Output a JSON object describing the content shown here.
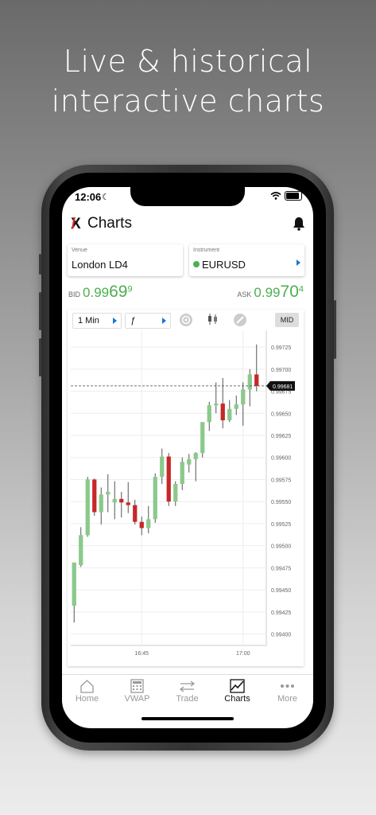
{
  "headline": [
    "Live & historical",
    "interactive charts"
  ],
  "status": {
    "time": "12:06"
  },
  "app": {
    "title": "Charts"
  },
  "venue": {
    "label": "Venue",
    "value": "London LD4"
  },
  "instrument": {
    "label": "Instrument",
    "value": "EURUSD"
  },
  "bid": {
    "label": "BID",
    "main": "0.99",
    "big": "69",
    "small": "9"
  },
  "ask": {
    "label": "ASK",
    "main": "0.99",
    "big": "70",
    "small": "4"
  },
  "toolbar": {
    "interval": "1 Min",
    "function": "ƒ",
    "mid_label": "MID"
  },
  "chart_data": {
    "type": "candlestick",
    "x_ticks": [
      "16:45",
      "17:00"
    ],
    "y_ticks": [
      "0.99725",
      "0.99700",
      "0.99675",
      "0.99650",
      "0.99625",
      "0.99600",
      "0.99575",
      "0.99550",
      "0.99525",
      "0.99500",
      "0.99475",
      "0.99450",
      "0.99425",
      "0.99400"
    ],
    "ylim": [
      0.99387,
      0.99744
    ],
    "current_price": "0.99681",
    "candles": [
      {
        "o": 0.99432,
        "h": 0.99478,
        "l": 0.99413,
        "c": 0.99481
      },
      {
        "o": 0.99478,
        "h": 0.99521,
        "l": 0.99476,
        "c": 0.99512
      },
      {
        "o": 0.99512,
        "h": 0.99578,
        "l": 0.9951,
        "c": 0.99575
      },
      {
        "o": 0.99575,
        "h": 0.99576,
        "l": 0.99534,
        "c": 0.99538
      },
      {
        "o": 0.99538,
        "h": 0.99566,
        "l": 0.99524,
        "c": 0.99558
      },
      {
        "o": 0.99558,
        "h": 0.99581,
        "l": 0.99538,
        "c": 0.99561
      },
      {
        "o": 0.99549,
        "h": 0.99573,
        "l": 0.9953,
        "c": 0.99553
      },
      {
        "o": 0.99553,
        "h": 0.99561,
        "l": 0.99532,
        "c": 0.99549
      },
      {
        "o": 0.99549,
        "h": 0.99572,
        "l": 0.99537,
        "c": 0.99546
      },
      {
        "o": 0.99546,
        "h": 0.99552,
        "l": 0.99524,
        "c": 0.99527
      },
      {
        "o": 0.99527,
        "h": 0.99533,
        "l": 0.99512,
        "c": 0.9952
      },
      {
        "o": 0.9952,
        "h": 0.99545,
        "l": 0.99514,
        "c": 0.9953
      },
      {
        "o": 0.9953,
        "h": 0.99582,
        "l": 0.99526,
        "c": 0.99578
      },
      {
        "o": 0.99578,
        "h": 0.9961,
        "l": 0.9957,
        "c": 0.99601
      },
      {
        "o": 0.99601,
        "h": 0.99605,
        "l": 0.99545,
        "c": 0.9955
      },
      {
        "o": 0.9955,
        "h": 0.99573,
        "l": 0.99545,
        "c": 0.9957
      },
      {
        "o": 0.9957,
        "h": 0.996,
        "l": 0.99563,
        "c": 0.99595
      },
      {
        "o": 0.99592,
        "h": 0.99604,
        "l": 0.99583,
        "c": 0.99598
      },
      {
        "o": 0.99598,
        "h": 0.99606,
        "l": 0.99573,
        "c": 0.99605
      },
      {
        "o": 0.99605,
        "h": 0.9964,
        "l": 0.996,
        "c": 0.9964
      },
      {
        "o": 0.9964,
        "h": 0.99663,
        "l": 0.9963,
        "c": 0.99659
      },
      {
        "o": 0.99659,
        "h": 0.99685,
        "l": 0.9965,
        "c": 0.99661
      },
      {
        "o": 0.99661,
        "h": 0.9969,
        "l": 0.99633,
        "c": 0.99642
      },
      {
        "o": 0.99642,
        "h": 0.99665,
        "l": 0.9964,
        "c": 0.99655
      },
      {
        "o": 0.99655,
        "h": 0.9967,
        "l": 0.99648,
        "c": 0.9966
      },
      {
        "o": 0.9966,
        "h": 0.99685,
        "l": 0.99636,
        "c": 0.99677
      },
      {
        "o": 0.99677,
        "h": 0.997,
        "l": 0.99658,
        "c": 0.99694
      },
      {
        "o": 0.99694,
        "h": 0.99728,
        "l": 0.99675,
        "c": 0.99681
      }
    ]
  },
  "tabs": [
    {
      "label": "Home",
      "icon": "home-icon",
      "active": false
    },
    {
      "label": "VWAP",
      "icon": "calculator-icon",
      "active": false
    },
    {
      "label": "Trade",
      "icon": "swap-arrows-icon",
      "active": false
    },
    {
      "label": "Charts",
      "icon": "chart-icon",
      "active": true
    },
    {
      "label": "More",
      "icon": "more-icon",
      "active": false
    }
  ]
}
